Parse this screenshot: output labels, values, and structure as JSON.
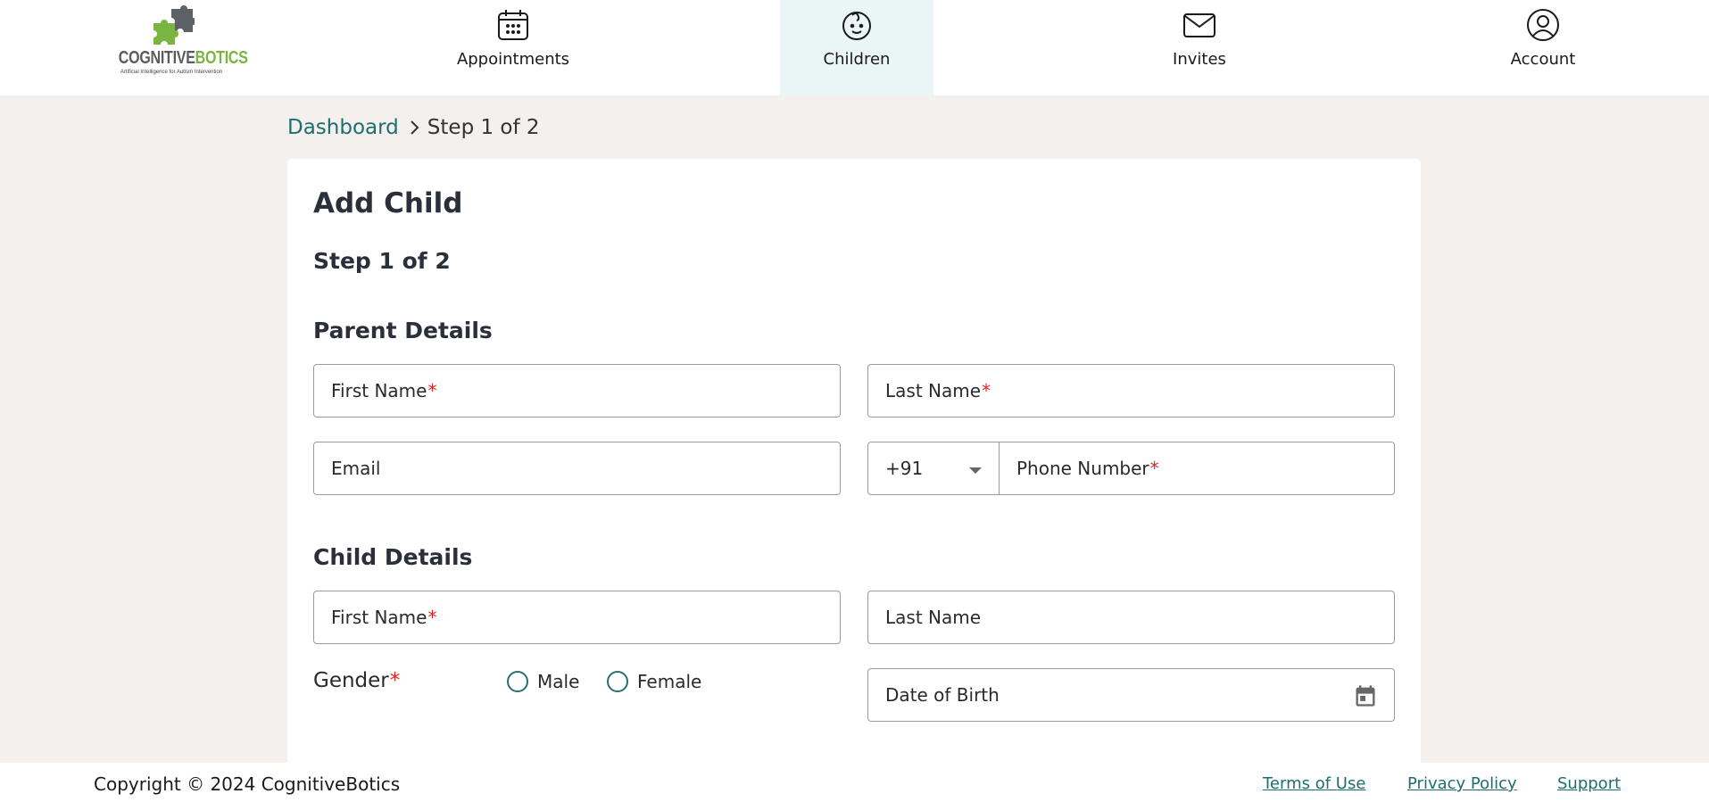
{
  "brand": {
    "name_main": "COGNITIVE",
    "name_accent": "BOTICS",
    "tagline": "Artificial Intelligence for Autism Intervention"
  },
  "nav": {
    "items": [
      {
        "label": "Appointments",
        "icon": "calendar-icon"
      },
      {
        "label": "Children",
        "icon": "child-face-icon",
        "active": true
      },
      {
        "label": "Invites",
        "icon": "envelope-icon"
      },
      {
        "label": "Account",
        "icon": "user-circle-icon"
      }
    ]
  },
  "breadcrumb": {
    "parent": "Dashboard",
    "current": "Step 1 of 2"
  },
  "form": {
    "title": "Add Child",
    "step": "Step 1 of 2",
    "parent_section": {
      "title": "Parent Details",
      "first_name": "First Name",
      "last_name": "Last Name",
      "email": "Email",
      "country_code": "+91",
      "phone": "Phone Number"
    },
    "child_section": {
      "title": "Child Details",
      "first_name": "First Name",
      "last_name": "Last Name",
      "gender_label": "Gender",
      "gender_options": [
        "Male",
        "Female"
      ],
      "dob": "Date of Birth"
    },
    "required_marker": "*"
  },
  "footer": {
    "copyright": "Copyright © 2024 CognitiveBotics",
    "links": [
      "Terms of Use",
      "Privacy Policy",
      "Support"
    ]
  },
  "colors": {
    "accent": "#1f6d70",
    "brand_green": "#7ab541",
    "required": "#e02424",
    "page_bg": "#f3f0ed",
    "active_nav_bg": "#eaf5f5"
  }
}
